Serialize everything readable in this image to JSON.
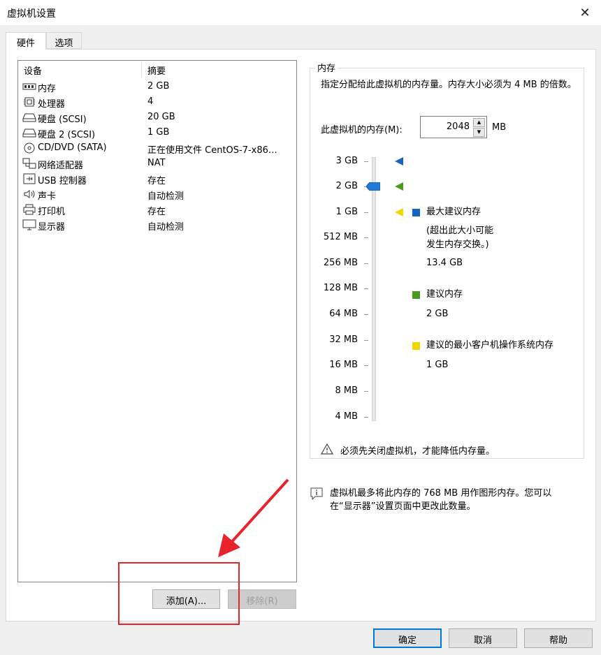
{
  "window": {
    "title": "虚拟机设置",
    "close_glyph": "✕"
  },
  "tabs": [
    {
      "label": "硬件"
    },
    {
      "label": "选项"
    }
  ],
  "device_table": {
    "headers": {
      "device": "设备",
      "summary": "摘要"
    },
    "rows": [
      {
        "icon": "memory-icon",
        "name": "内存",
        "summary": "2 GB"
      },
      {
        "icon": "processor-icon",
        "name": "处理器",
        "summary": "4"
      },
      {
        "icon": "hard-disk-icon",
        "name": "硬盘 (SCSI)",
        "summary": "20 GB"
      },
      {
        "icon": "hard-disk-icon",
        "name": "硬盘 2 (SCSI)",
        "summary": "1 GB"
      },
      {
        "icon": "cd-dvd-icon",
        "name": "CD/DVD (SATA)",
        "summary": "正在使用文件 CentOS-7-x86…"
      },
      {
        "icon": "network-adapter-icon",
        "name": "网络适配器",
        "summary": "NAT"
      },
      {
        "icon": "usb-icon",
        "name": "USB 控制器",
        "summary": "存在"
      },
      {
        "icon": "sound-card-icon",
        "name": "声卡",
        "summary": "自动检测"
      },
      {
        "icon": "printer-icon",
        "name": "打印机",
        "summary": "存在"
      },
      {
        "icon": "display-icon",
        "name": "显示器",
        "summary": "自动检测"
      }
    ]
  },
  "buttons": {
    "add": "添加(A)...",
    "remove": "移除(R)",
    "ok": "确定",
    "cancel": "取消",
    "help": "帮助"
  },
  "memory": {
    "group_title": "内存",
    "description": "指定分配给此虚拟机的内存量。内存大小必须为 4 MB 的倍数。",
    "field_label": "此虚拟机的内存(M):",
    "value": "2048",
    "unit": "MB",
    "scale_labels": [
      "3 GB",
      "2 GB",
      "1 GB",
      "512 MB",
      "256 MB",
      "128 MB",
      "64 MB",
      "32 MB",
      "16 MB",
      "8 MB",
      "4 MB"
    ],
    "legend": {
      "max_recommended": {
        "label": "最大建议内存",
        "note_line1": "(超出此大小可能",
        "note_line2": "发生内存交换。)",
        "value": "13.4 GB",
        "color": "#1565c0"
      },
      "recommended": {
        "label": "建议内存",
        "value": "2 GB",
        "color": "#4c9a1f"
      },
      "min_recommended": {
        "label": "建议的最小客户机操作系统内存",
        "value": "1 GB",
        "color": "#f2d600"
      }
    },
    "warning": "必须先关闭虚拟机，才能降低内存量。",
    "info_line1": "虚拟机最多将此内存的 768 MB 用作图形内存。您可以",
    "info_line2": "在“显示器”设置页面中更改此数量。"
  },
  "colors": {
    "accent": "#0078d7",
    "annotation": "#e8232b"
  }
}
